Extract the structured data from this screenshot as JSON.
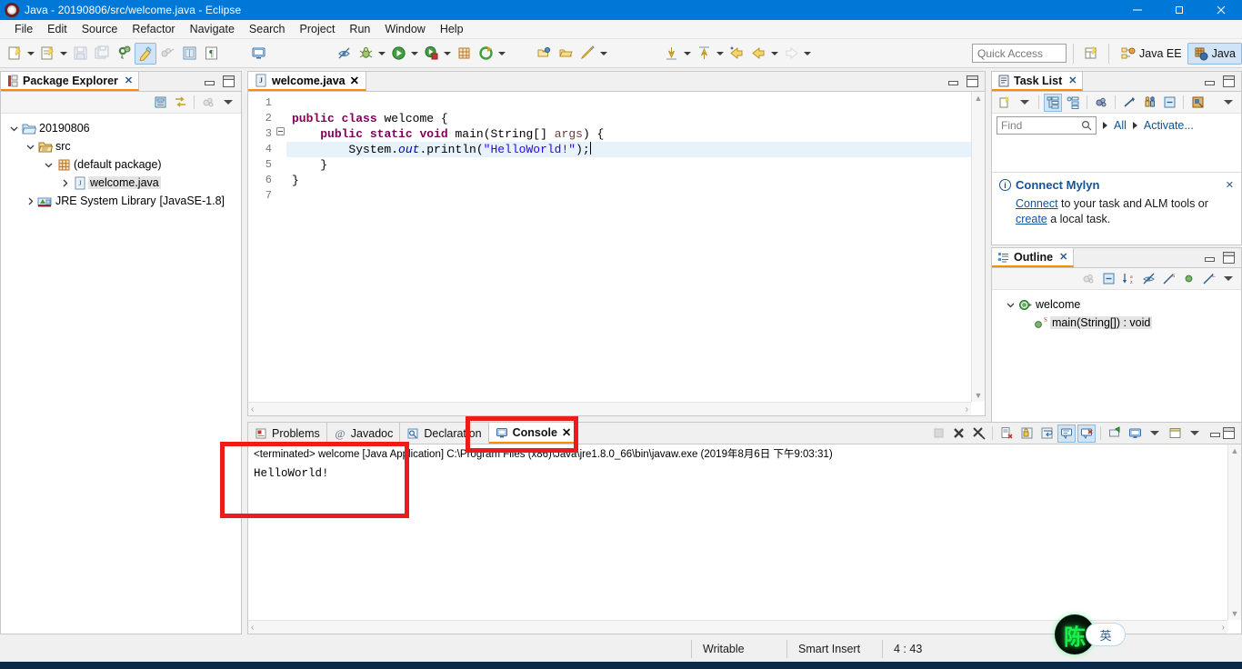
{
  "window": {
    "title": "Java - 20190806/src/welcome.java - Eclipse",
    "app_icon": "eclipse-icon",
    "minimize": "–",
    "maximize": "❐",
    "close": "✕"
  },
  "menubar": {
    "items": [
      "File",
      "Edit",
      "Source",
      "Refactor",
      "Navigate",
      "Search",
      "Project",
      "Run",
      "Window",
      "Help"
    ]
  },
  "toolbar": {
    "quick_access_placeholder": "Quick Access",
    "perspectives": [
      {
        "label": "Java EE",
        "icon": "javaee-perspective-icon",
        "active": false
      },
      {
        "label": "Java",
        "icon": "java-perspective-icon",
        "active": true
      }
    ],
    "open_perspective_icon": "open-perspective-icon",
    "icons": [
      "new-wizard-icon",
      "new-java-project-icon",
      "save-icon",
      "save-all-icon",
      "print-icon",
      "highlight-icon",
      "build-icon",
      "toggle-mark-occurrences-icon",
      "show-whitespace-icon",
      "open-type-icon",
      "debug-icon",
      "run-icon",
      "run-coverage-icon",
      "new-java-package-icon",
      "external-tools-icon",
      "open-task-icon",
      "open-folder-icon",
      "annotation-icon",
      "next-annotation-icon",
      "previous-annotation-icon",
      "last-edit-icon",
      "back-icon",
      "forward-icon"
    ]
  },
  "package_explorer": {
    "title": "Package Explorer",
    "close_label": "✕",
    "toolbar_icons": [
      "collapse-all-icon",
      "link-with-editor-icon",
      "focus-on-active-task-icon",
      "view-menu-icon"
    ],
    "minimize_label": "minimize",
    "maximize_label": "maximize",
    "tree": [
      {
        "label": "20190806",
        "icon": "project-folder-icon",
        "indent": 0,
        "expanded": true,
        "selected": false,
        "suffix": ""
      },
      {
        "label": "src",
        "icon": "source-folder-icon",
        "indent": 1,
        "expanded": true,
        "selected": false,
        "suffix": ""
      },
      {
        "label": "(default package)",
        "icon": "package-icon",
        "indent": 2,
        "expanded": true,
        "selected": false,
        "suffix": ""
      },
      {
        "label": "welcome.java",
        "icon": "java-file-icon",
        "indent": 3,
        "expanded": false,
        "selected": true,
        "suffix": ""
      },
      {
        "label": "JRE System Library",
        "icon": "jre-library-icon",
        "indent": 1,
        "expanded": false,
        "selected": false,
        "suffix": "[JavaSE-1.8]"
      }
    ]
  },
  "editor": {
    "tab_label": "welcome.java",
    "tab_icon": "java-file-icon",
    "tab_close": "✕",
    "minimize_label": "minimize",
    "maximize_label": "maximize",
    "cursor_line": 4,
    "lines": [
      {
        "no": 1,
        "text": "",
        "current": false,
        "fold": false
      },
      {
        "no": 2,
        "text": "public class welcome {",
        "current": false,
        "fold": false
      },
      {
        "no": 3,
        "text": "    public static void main(String[] args) {",
        "current": false,
        "fold": true
      },
      {
        "no": 4,
        "text": "        System.out.println(\"HelloWorld!\");",
        "current": true,
        "fold": false
      },
      {
        "no": 5,
        "text": "    }",
        "current": false,
        "fold": false
      },
      {
        "no": 6,
        "text": "}",
        "current": false,
        "fold": false
      },
      {
        "no": 7,
        "text": "",
        "current": false,
        "fold": false
      }
    ]
  },
  "task_list": {
    "title": "Task List",
    "close_label": "✕",
    "find_placeholder": "Find",
    "search_icon": "search-icon",
    "filter_all": "All",
    "filter_activate": "Activate...",
    "toolbar_icons": [
      "new-task-icon",
      "categorized-icon",
      "scheduled-icon",
      "focus-icon",
      "synchronize-icon",
      "collapse-all-icon",
      "presentation-icon",
      "view-menu-icon"
    ],
    "notice": {
      "icon": "info-icon",
      "title": "Connect Mylyn",
      "link1": "Connect",
      "text1": " to your task and ALM tools or ",
      "link2": "create",
      "text2": " a local task.",
      "close": "✕"
    }
  },
  "outline": {
    "title": "Outline",
    "close_label": "✕",
    "toolbar_icons": [
      "focus-icon",
      "collapse-all-icon",
      "sort-icon",
      "hide-fields-icon",
      "hide-static-icon",
      "hide-nonpublic-icon",
      "hide-local-icon",
      "view-menu-icon"
    ],
    "tree": [
      {
        "label": "welcome",
        "icon": "class-icon",
        "indent": 0,
        "expanded": true,
        "selected": false,
        "badge": ""
      },
      {
        "label": "main(String[]) : void",
        "icon": "method-public-icon",
        "indent": 1,
        "expanded": false,
        "selected": true,
        "badge": "S"
      }
    ]
  },
  "console": {
    "tabs": [
      {
        "label": "Problems",
        "icon": "problems-icon",
        "active": false,
        "close": ""
      },
      {
        "label": "Javadoc",
        "icon": "javadoc-icon",
        "active": false,
        "close": ""
      },
      {
        "label": "Declaration",
        "icon": "declaration-icon",
        "active": false,
        "close": ""
      },
      {
        "label": "Console",
        "icon": "console-icon",
        "active": true,
        "close": "✕"
      }
    ],
    "toolbar_icons": [
      "terminate-icon",
      "remove-launch-icon",
      "remove-all-terminated-icon",
      "clear-console-icon",
      "scroll-lock-icon",
      "word-wrap-icon",
      "show-console-on-output-icon",
      "show-console-on-error-icon",
      "pin-console-icon",
      "display-selected-console-icon",
      "open-console-icon"
    ],
    "minimize_label": "minimize",
    "maximize_label": "maximize",
    "header_line": "<terminated> welcome [Java Application] C:\\Program Files (x86)\\Java\\jre1.8.0_66\\bin\\javaw.exe (2019年8月6日 下午9:03:31)",
    "output_lines": [
      "HelloWorld!"
    ]
  },
  "statusbar": {
    "writable": "Writable",
    "insert_mode": "Smart Insert",
    "position": "4 : 43"
  },
  "ime": {
    "logo_char": "陈",
    "mode_label": "英"
  },
  "annotations": [
    {
      "name": "console-tab-highlight",
      "color": "#ee1b1b"
    },
    {
      "name": "console-output-highlight",
      "color": "#ee1b1b"
    }
  ]
}
